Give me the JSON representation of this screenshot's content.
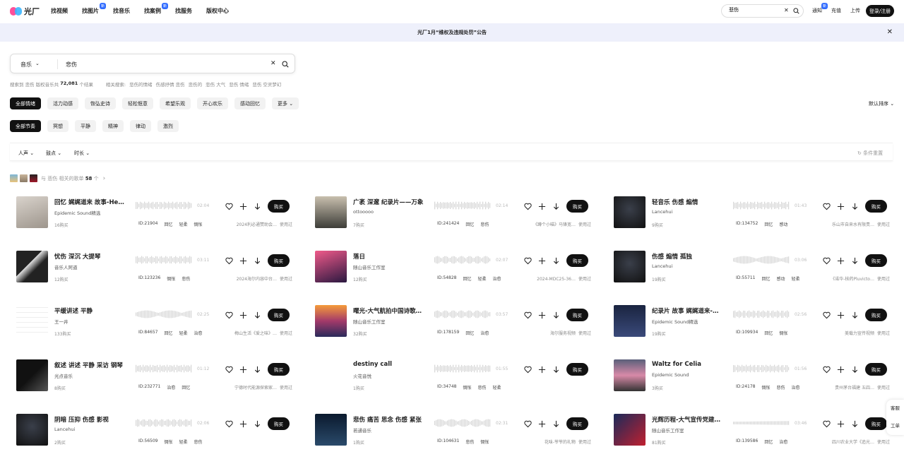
{
  "header": {
    "logo_text": "光厂",
    "nav": [
      {
        "label": "找视频",
        "badge": ""
      },
      {
        "label": "找图片",
        "badge": "新"
      },
      {
        "label": "找音乐",
        "badge": ""
      },
      {
        "label": "找案例",
        "badge": "新"
      },
      {
        "label": "找服务",
        "badge": ""
      },
      {
        "label": "版权中心",
        "badge": ""
      }
    ],
    "search_value": "悲伤",
    "links": [
      {
        "label": "通知",
        "badge": "新"
      },
      {
        "label": "充值",
        "badge": ""
      },
      {
        "label": "上传",
        "badge": ""
      }
    ],
    "login_label": "登录/注册"
  },
  "notice": {
    "text": "光厂1月“维权及违规处罚”公告"
  },
  "search": {
    "category": "音乐",
    "query": "悲伤"
  },
  "results": {
    "prefix": "搜索到 悲伤 版权音乐共",
    "count": "72,081",
    "suffix": "个结果",
    "related_label": "相关搜索:",
    "related": [
      "悲伤的情绪",
      "伤感抒情 悲伤",
      "悲伤的",
      "悲伤 大气",
      "悲伤 情绪",
      "悲伤 空灵梦幻"
    ]
  },
  "mood_chips": [
    "全部情绪",
    "活力动感",
    "恢弘史诗",
    "轻松惬意",
    "希望乐观",
    "开心欢乐",
    "感动回忆",
    "更多"
  ],
  "rhythm_chips": [
    "全部节奏",
    "冥想",
    "平静",
    "精神",
    "律动",
    "激烈"
  ],
  "sort_label": "默认排序",
  "filters": [
    "人声",
    "鼓点",
    "时长"
  ],
  "reset_label": "条件重置",
  "playlist": {
    "prefix": "与 悲伤 相关的歌单",
    "count": "58",
    "suffix": "个"
  },
  "buy_label": "购买",
  "use_label": "使用过",
  "tracks": [
    {
      "title": "回忆 娓娓道来 故事-Heartfelt",
      "artist": "Epidemic Sound精选",
      "buys": "16购买",
      "duration": "02:04",
      "id": "ID:21904",
      "tags": [
        "回忆",
        "轻柔",
        "惆怅"
      ],
      "usage": "2024利必通赞助会…"
    },
    {
      "title": "广袤 深邃 纪录片——万象",
      "artist": "ottooooo",
      "buys": "7购买",
      "duration": "02:14",
      "id": "ID:241424",
      "tags": [
        "回忆",
        "悲伤"
      ],
      "usage": "《蹲个小喵》马锋宽…"
    },
    {
      "title": "轻音乐 伤感 煽情",
      "artist": "Lancehui",
      "buys": "9购买",
      "duration": "01:43",
      "id": "ID:134752",
      "tags": [
        "回忆",
        "感动"
      ],
      "usage": "乐山市自来水有限责…"
    },
    {
      "title": "忧伤 深沉 大提琴",
      "artist": "音乐人阿道",
      "buys": "12购买",
      "duration": "03:11",
      "id": "ID:123236",
      "tags": [
        "惆怅",
        "悲伤"
      ],
      "usage": "2024海尔内容中台…"
    },
    {
      "title": "落日",
      "artist": "随山音乐工作室",
      "buys": "12购买",
      "duration": "02:07",
      "id": "ID:54828",
      "tags": [
        "回忆",
        "轻柔",
        "治愈"
      ],
      "usage": "2024-MDC25-36…"
    },
    {
      "title": "伤感 煽情 孤独",
      "artist": "Lancehui",
      "buys": "19购买",
      "duration": "03:06",
      "id": "ID:55711",
      "tags": [
        "回忆",
        "感动",
        "轻柔"
      ],
      "usage": "《诺华-核药Pluvicto…"
    },
    {
      "title": "平缓讲述 平静",
      "artist": "王一井",
      "buys": "133购买",
      "duration": "02:25",
      "id": "ID:84657",
      "tags": [
        "回忆",
        "轻柔",
        "治愈"
      ],
      "usage": "梅山生活《爱之味》…"
    },
    {
      "title": "曙光-大气航拍中国诗歌朗诵",
      "artist": "随山音乐工作室",
      "buys": "32购买",
      "duration": "03:57",
      "id": "ID:178159",
      "tags": [
        "回忆",
        "治愈"
      ],
      "usage": "海尔服务视频"
    },
    {
      "title": "纪录片 故事 娓娓道来-Blue",
      "artist": "Epidemic Sound精选",
      "buys": "19购买",
      "duration": "02:56",
      "id": "ID:109934",
      "tags": [
        "回忆",
        "惆怅"
      ],
      "usage": "美载力宣传视频"
    },
    {
      "title": "叙述 讲述 平静 采访 钢琴",
      "artist": "光点音乐",
      "buys": "8购买",
      "duration": "01:12",
      "id": "ID:232771",
      "tags": [
        "治愈",
        "回忆"
      ],
      "usage": "宁德时代能源探索家…"
    },
    {
      "title": "destiny call",
      "artist": "火花音悦",
      "buys": "1购买",
      "duration": "01:55",
      "id": "ID:34748",
      "tags": [
        "惆怅",
        "悲伤",
        "轻柔"
      ],
      "usage": ""
    },
    {
      "title": "Waltz for Celia",
      "artist": "Epidemic Sound",
      "buys": "3购买",
      "duration": "01:56",
      "id": "ID:24178",
      "tags": [
        "惆怅",
        "悲伤",
        "治愈"
      ],
      "usage": "贵州茅台福建 五四…"
    },
    {
      "title": "阴暗 压抑 伤感 影视",
      "artist": "Lancehui",
      "buys": "2购买",
      "duration": "02:06",
      "id": "ID:56509",
      "tags": [
        "惆怅",
        "轻柔",
        "悲伤"
      ],
      "usage": ""
    },
    {
      "title": "悲伤 痛苦 思念 伤感 紧张",
      "artist": "若通音乐",
      "buys": "1购买",
      "duration": "02:31",
      "id": "ID:104631",
      "tags": [
        "悲伤",
        "惆怅"
      ],
      "usage": "花味-爷爷的礼物"
    },
    {
      "title": "光辉历程-大气宣传党建红色",
      "artist": "随山音乐工作室",
      "buys": "81购买",
      "duration": "03:46",
      "id": "ID:139586",
      "tags": [
        "回忆",
        "治愈"
      ],
      "usage": "四川农业大学《追光…"
    }
  ],
  "side": [
    "客服",
    "工单"
  ],
  "colors": {
    "accent": "#2f6bff",
    "dark": "#111111",
    "notice_bg": "#eef0fb"
  }
}
